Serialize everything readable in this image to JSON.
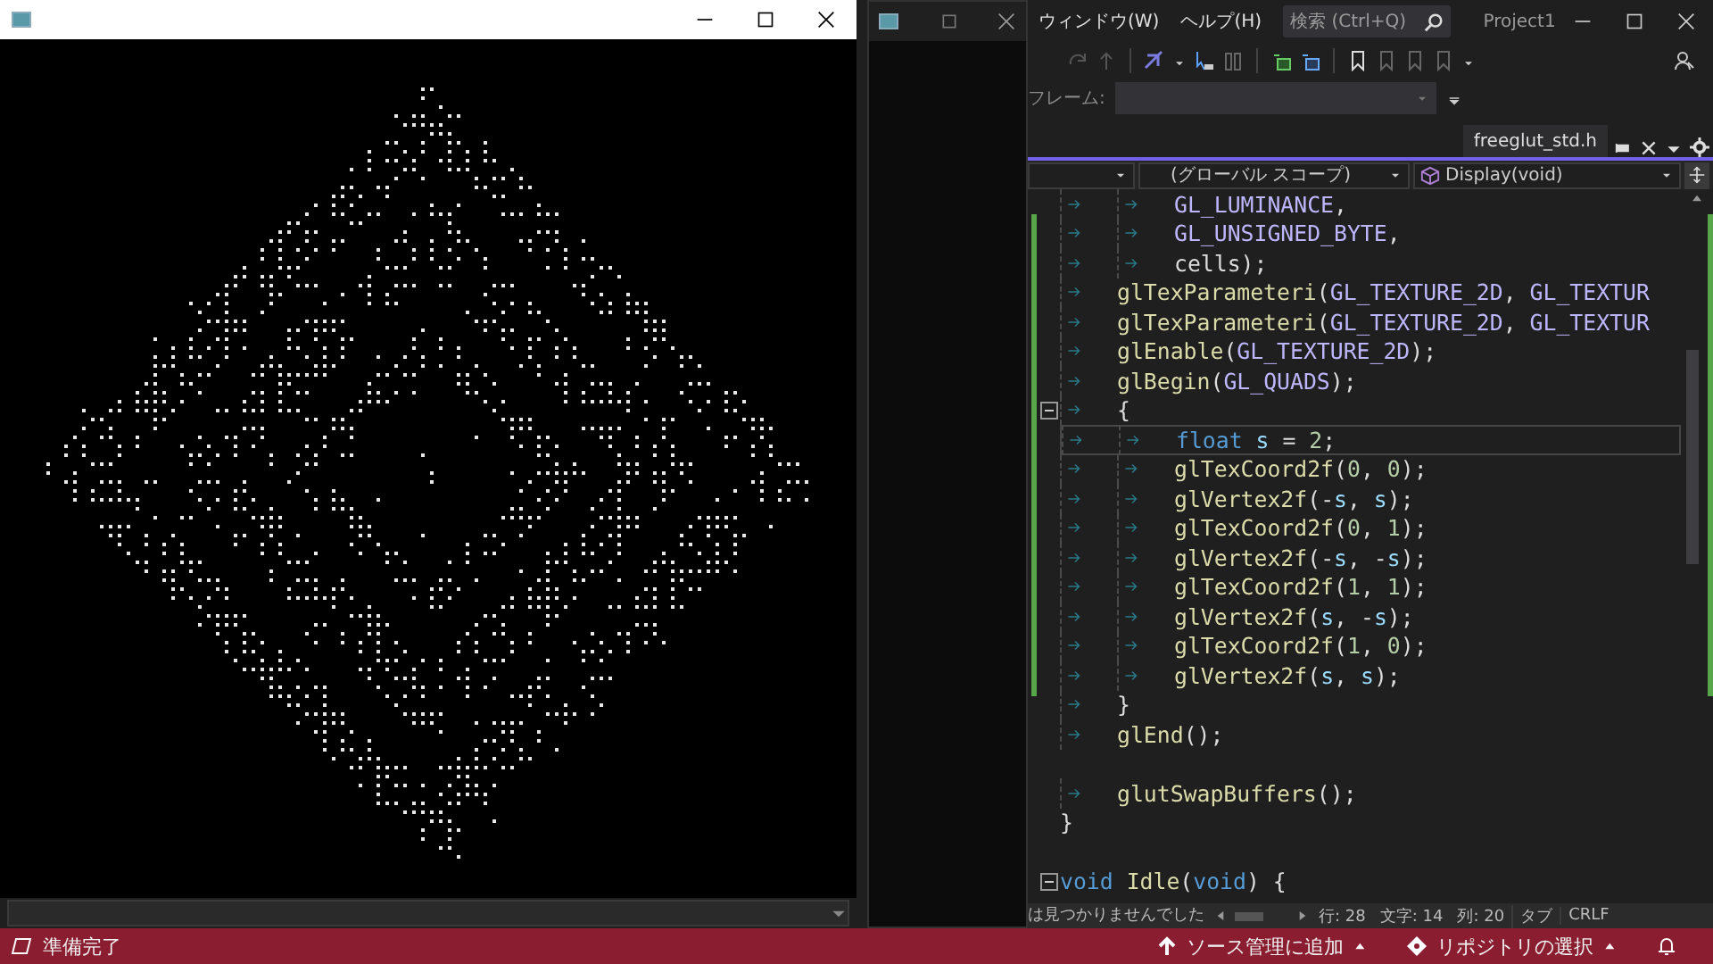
{
  "ide": {
    "menu": [
      {
        "label": "ウィンドウ(W)"
      },
      {
        "label": "ヘルプ(H)"
      }
    ],
    "search": {
      "placeholder": "検索 (Ctrl+Q)"
    },
    "project": "Project1",
    "frame_label": "フレーム:",
    "tab": {
      "label": "freeglut_std.h"
    },
    "nav": {
      "scope": "(グローバル スコープ)",
      "member": "Display(void)"
    },
    "code_lines": [
      {
        "current": false,
        "fold": false,
        "tokens": [
          {
            "kind": "tab"
          },
          {
            "kind": "tab"
          },
          {
            "kind": "macro",
            "text": "GL_LUMINANCE"
          },
          {
            "kind": "plain",
            "text": ","
          }
        ]
      },
      {
        "current": false,
        "fold": false,
        "tokens": [
          {
            "kind": "tab"
          },
          {
            "kind": "tab"
          },
          {
            "kind": "macro",
            "text": "GL_UNSIGNED_BYTE"
          },
          {
            "kind": "plain",
            "text": ","
          }
        ]
      },
      {
        "current": false,
        "fold": false,
        "tokens": [
          {
            "kind": "tab"
          },
          {
            "kind": "tab"
          },
          {
            "kind": "plain",
            "text": "cells);"
          }
        ]
      },
      {
        "current": false,
        "fold": false,
        "tokens": [
          {
            "kind": "tab"
          },
          {
            "kind": "func",
            "text": "glTexParameteri"
          },
          {
            "kind": "plain",
            "text": "("
          },
          {
            "kind": "macro",
            "text": "GL_TEXTURE_2D"
          },
          {
            "kind": "plain",
            "text": ", "
          },
          {
            "kind": "macro",
            "text": "GL_TEXTUR"
          }
        ]
      },
      {
        "current": false,
        "fold": false,
        "tokens": [
          {
            "kind": "tab"
          },
          {
            "kind": "func",
            "text": "glTexParameteri"
          },
          {
            "kind": "plain",
            "text": "("
          },
          {
            "kind": "macro",
            "text": "GL_TEXTURE_2D"
          },
          {
            "kind": "plain",
            "text": ", "
          },
          {
            "kind": "macro",
            "text": "GL_TEXTUR"
          }
        ]
      },
      {
        "current": false,
        "fold": false,
        "tokens": [
          {
            "kind": "tab"
          },
          {
            "kind": "func",
            "text": "glEnable"
          },
          {
            "kind": "plain",
            "text": "("
          },
          {
            "kind": "macro",
            "text": "GL_TEXTURE_2D"
          },
          {
            "kind": "plain",
            "text": ");"
          }
        ]
      },
      {
        "current": false,
        "fold": false,
        "tokens": [
          {
            "kind": "tab"
          },
          {
            "kind": "func",
            "text": "glBegin"
          },
          {
            "kind": "plain",
            "text": "("
          },
          {
            "kind": "macro",
            "text": "GL_QUADS"
          },
          {
            "kind": "plain",
            "text": ");"
          }
        ]
      },
      {
        "current": false,
        "fold": true,
        "tokens": [
          {
            "kind": "tab"
          },
          {
            "kind": "plain",
            "text": "{"
          }
        ]
      },
      {
        "current": true,
        "fold": false,
        "tokens": [
          {
            "kind": "tab"
          },
          {
            "kind": "tab"
          },
          {
            "kind": "keyword",
            "text": "float "
          },
          {
            "kind": "param",
            "text": "s"
          },
          {
            "kind": "plain",
            "text": " = "
          },
          {
            "kind": "number",
            "text": "2"
          },
          {
            "kind": "plain",
            "text": ";"
          }
        ]
      },
      {
        "current": false,
        "fold": false,
        "tokens": [
          {
            "kind": "tab"
          },
          {
            "kind": "tab"
          },
          {
            "kind": "func",
            "text": "glTexCoord2f"
          },
          {
            "kind": "plain",
            "text": "("
          },
          {
            "kind": "number",
            "text": "0"
          },
          {
            "kind": "plain",
            "text": ", "
          },
          {
            "kind": "number",
            "text": "0"
          },
          {
            "kind": "plain",
            "text": ");"
          }
        ]
      },
      {
        "current": false,
        "fold": false,
        "tokens": [
          {
            "kind": "tab"
          },
          {
            "kind": "tab"
          },
          {
            "kind": "func",
            "text": "glVertex2f"
          },
          {
            "kind": "plain",
            "text": "(-"
          },
          {
            "kind": "param",
            "text": "s"
          },
          {
            "kind": "plain",
            "text": ", "
          },
          {
            "kind": "param",
            "text": "s"
          },
          {
            "kind": "plain",
            "text": ");"
          }
        ]
      },
      {
        "current": false,
        "fold": false,
        "tokens": [
          {
            "kind": "tab"
          },
          {
            "kind": "tab"
          },
          {
            "kind": "func",
            "text": "glTexCoord2f"
          },
          {
            "kind": "plain",
            "text": "("
          },
          {
            "kind": "number",
            "text": "0"
          },
          {
            "kind": "plain",
            "text": ", "
          },
          {
            "kind": "number",
            "text": "1"
          },
          {
            "kind": "plain",
            "text": ");"
          }
        ]
      },
      {
        "current": false,
        "fold": false,
        "tokens": [
          {
            "kind": "tab"
          },
          {
            "kind": "tab"
          },
          {
            "kind": "func",
            "text": "glVertex2f"
          },
          {
            "kind": "plain",
            "text": "(-"
          },
          {
            "kind": "param",
            "text": "s"
          },
          {
            "kind": "plain",
            "text": ", -"
          },
          {
            "kind": "param",
            "text": "s"
          },
          {
            "kind": "plain",
            "text": ");"
          }
        ]
      },
      {
        "current": false,
        "fold": false,
        "tokens": [
          {
            "kind": "tab"
          },
          {
            "kind": "tab"
          },
          {
            "kind": "func",
            "text": "glTexCoord2f"
          },
          {
            "kind": "plain",
            "text": "("
          },
          {
            "kind": "number",
            "text": "1"
          },
          {
            "kind": "plain",
            "text": ", "
          },
          {
            "kind": "number",
            "text": "1"
          },
          {
            "kind": "plain",
            "text": ");"
          }
        ]
      },
      {
        "current": false,
        "fold": false,
        "tokens": [
          {
            "kind": "tab"
          },
          {
            "kind": "tab"
          },
          {
            "kind": "func",
            "text": "glVertex2f"
          },
          {
            "kind": "plain",
            "text": "("
          },
          {
            "kind": "param",
            "text": "s"
          },
          {
            "kind": "plain",
            "text": ", -"
          },
          {
            "kind": "param",
            "text": "s"
          },
          {
            "kind": "plain",
            "text": ");"
          }
        ]
      },
      {
        "current": false,
        "fold": false,
        "tokens": [
          {
            "kind": "tab"
          },
          {
            "kind": "tab"
          },
          {
            "kind": "func",
            "text": "glTexCoord2f"
          },
          {
            "kind": "plain",
            "text": "("
          },
          {
            "kind": "number",
            "text": "1"
          },
          {
            "kind": "plain",
            "text": ", "
          },
          {
            "kind": "number",
            "text": "0"
          },
          {
            "kind": "plain",
            "text": ");"
          }
        ]
      },
      {
        "current": false,
        "fold": false,
        "tokens": [
          {
            "kind": "tab"
          },
          {
            "kind": "tab"
          },
          {
            "kind": "func",
            "text": "glVertex2f"
          },
          {
            "kind": "plain",
            "text": "("
          },
          {
            "kind": "param",
            "text": "s"
          },
          {
            "kind": "plain",
            "text": ", "
          },
          {
            "kind": "param",
            "text": "s"
          },
          {
            "kind": "plain",
            "text": ");"
          }
        ]
      },
      {
        "current": false,
        "fold": false,
        "tokens": [
          {
            "kind": "tab"
          },
          {
            "kind": "plain",
            "text": "}"
          }
        ]
      },
      {
        "current": false,
        "fold": false,
        "tokens": [
          {
            "kind": "tab"
          },
          {
            "kind": "func",
            "text": "glEnd"
          },
          {
            "kind": "plain",
            "text": "();"
          }
        ]
      },
      {
        "current": false,
        "fold": false
      },
      {
        "current": false,
        "fold": false,
        "tokens": [
          {
            "kind": "tab"
          },
          {
            "kind": "func",
            "text": "glutSwapBuffers"
          },
          {
            "kind": "plain",
            "text": "();"
          }
        ]
      },
      {
        "current": false,
        "fold": false,
        "tokens": [
          {
            "kind": "plain",
            "text": "}"
          }
        ]
      },
      {
        "current": false,
        "fold": false
      },
      {
        "current": false,
        "fold": true,
        "tokens": [
          {
            "kind": "keyword",
            "text": "void "
          },
          {
            "kind": "func",
            "text": "Idle"
          },
          {
            "kind": "plain",
            "text": "("
          },
          {
            "kind": "keyword",
            "text": "void"
          },
          {
            "kind": "plain",
            "text": ") {"
          }
        ]
      }
    ],
    "find_message": "は見つかりませんでした",
    "cursor": {
      "line": "行: 28",
      "char": "文字: 14",
      "col": "列: 20"
    },
    "indent_mode": "タブ",
    "line_ending": "CRLF"
  },
  "status_bar": {
    "message": "準備完了",
    "source_control": "ソース管理に追加",
    "repository": "リポジトリの選択"
  }
}
